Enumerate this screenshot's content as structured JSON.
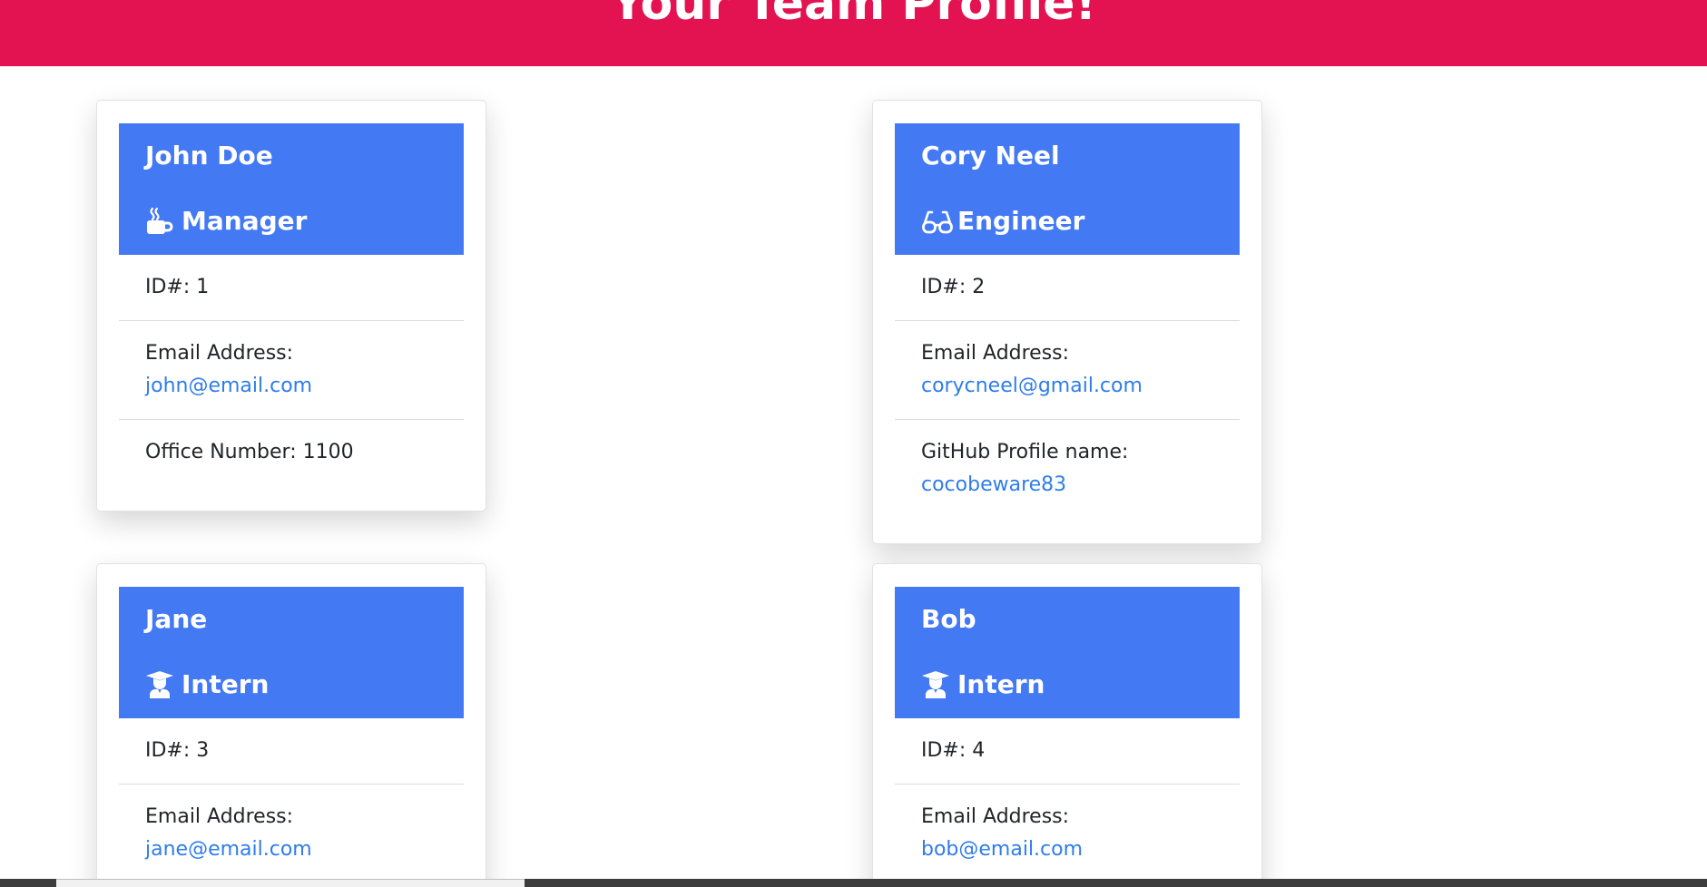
{
  "page": {
    "banner_title": "Your Team Profile!"
  },
  "colors": {
    "banner": "#e31250",
    "card_header": "#4479f4",
    "link": "#2f7dea"
  },
  "employees": [
    {
      "name": "John Doe",
      "role": "Manager",
      "role_icon": "mug-icon",
      "id_text": "ID#: 1",
      "email_label": "Email Address:",
      "email": "john@email.com",
      "extra_text": "Office Number: 1100"
    },
    {
      "name": "Cory Neel",
      "role": "Engineer",
      "role_icon": "glasses-icon",
      "id_text": "ID#: 2",
      "email_label": "Email Address:",
      "email": "corycneel@gmail.com",
      "extra_label": "GitHub Profile name:",
      "extra_link": "cocobeware83"
    },
    {
      "name": "Jane",
      "role": "Intern",
      "role_icon": "graduate-icon",
      "id_text": "ID#: 3",
      "email_label": "Email Address:",
      "email": "jane@email.com"
    },
    {
      "name": "Bob",
      "role": "Intern",
      "role_icon": "graduate-icon",
      "id_text": "ID#: 4",
      "email_label": "Email Address:",
      "email": "bob@email.com"
    }
  ]
}
